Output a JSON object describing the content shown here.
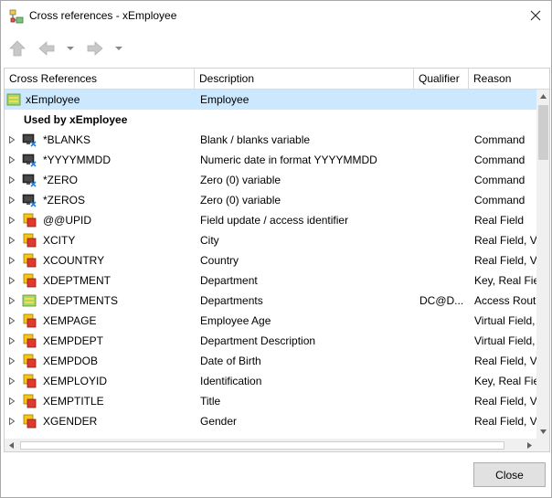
{
  "window": {
    "title": "Cross references - xEmployee"
  },
  "toolbar": {
    "home_icon": "home-icon",
    "back_icon": "back-arrow-icon",
    "forward_icon": "forward-arrow-icon"
  },
  "columns": [
    "Cross References",
    "Description",
    "Qualifier",
    "Reason"
  ],
  "root": {
    "name": "xEmployee",
    "description": "Employee"
  },
  "group_label": "Used by xEmployee",
  "rows": [
    {
      "name": "*BLANKS",
      "description": "Blank / blanks variable",
      "qualifier": "",
      "reason": "Command",
      "icon": "system-variable"
    },
    {
      "name": "*YYYYMMDD",
      "description": "Numeric date in format YYYYMMDD",
      "qualifier": "",
      "reason": "Command",
      "icon": "system-variable"
    },
    {
      "name": "*ZERO",
      "description": "Zero (0) variable",
      "qualifier": "",
      "reason": "Command",
      "icon": "system-variable"
    },
    {
      "name": "*ZEROS",
      "description": "Zero (0) variable",
      "qualifier": "",
      "reason": "Command",
      "icon": "system-variable"
    },
    {
      "name": "@@UPID",
      "description": "Field update / access identifier",
      "qualifier": "",
      "reason": "Real Field",
      "icon": "field"
    },
    {
      "name": "XCITY",
      "description": "City",
      "qualifier": "",
      "reason": "Real Field, Va",
      "icon": "field"
    },
    {
      "name": "XCOUNTRY",
      "description": "Country",
      "qualifier": "",
      "reason": "Real Field, Va",
      "icon": "field"
    },
    {
      "name": "XDEPTMENT",
      "description": "Department",
      "qualifier": "",
      "reason": "Key, Real Fie",
      "icon": "field"
    },
    {
      "name": "XDEPTMENTS",
      "description": "Departments",
      "qualifier": "DC@D...",
      "reason": "Access Rout.",
      "icon": "file"
    },
    {
      "name": "XEMPAGE",
      "description": "Employee Age",
      "qualifier": "",
      "reason": "Virtual Field,",
      "icon": "field"
    },
    {
      "name": "XEMPDEPT",
      "description": "Department Description",
      "qualifier": "",
      "reason": "Virtual Field,",
      "icon": "field"
    },
    {
      "name": "XEMPDOB",
      "description": "Date of Birth",
      "qualifier": "",
      "reason": "Real Field, Va",
      "icon": "field"
    },
    {
      "name": "XEMPLOYID",
      "description": "Identification",
      "qualifier": "",
      "reason": "Key, Real Fie",
      "icon": "field"
    },
    {
      "name": "XEMPTITLE",
      "description": "Title",
      "qualifier": "",
      "reason": "Real Field, Va",
      "icon": "field"
    },
    {
      "name": "XGENDER",
      "description": "Gender",
      "qualifier": "",
      "reason": "Real Field, Va",
      "icon": "field"
    }
  ],
  "footer": {
    "close_label": "Close"
  }
}
